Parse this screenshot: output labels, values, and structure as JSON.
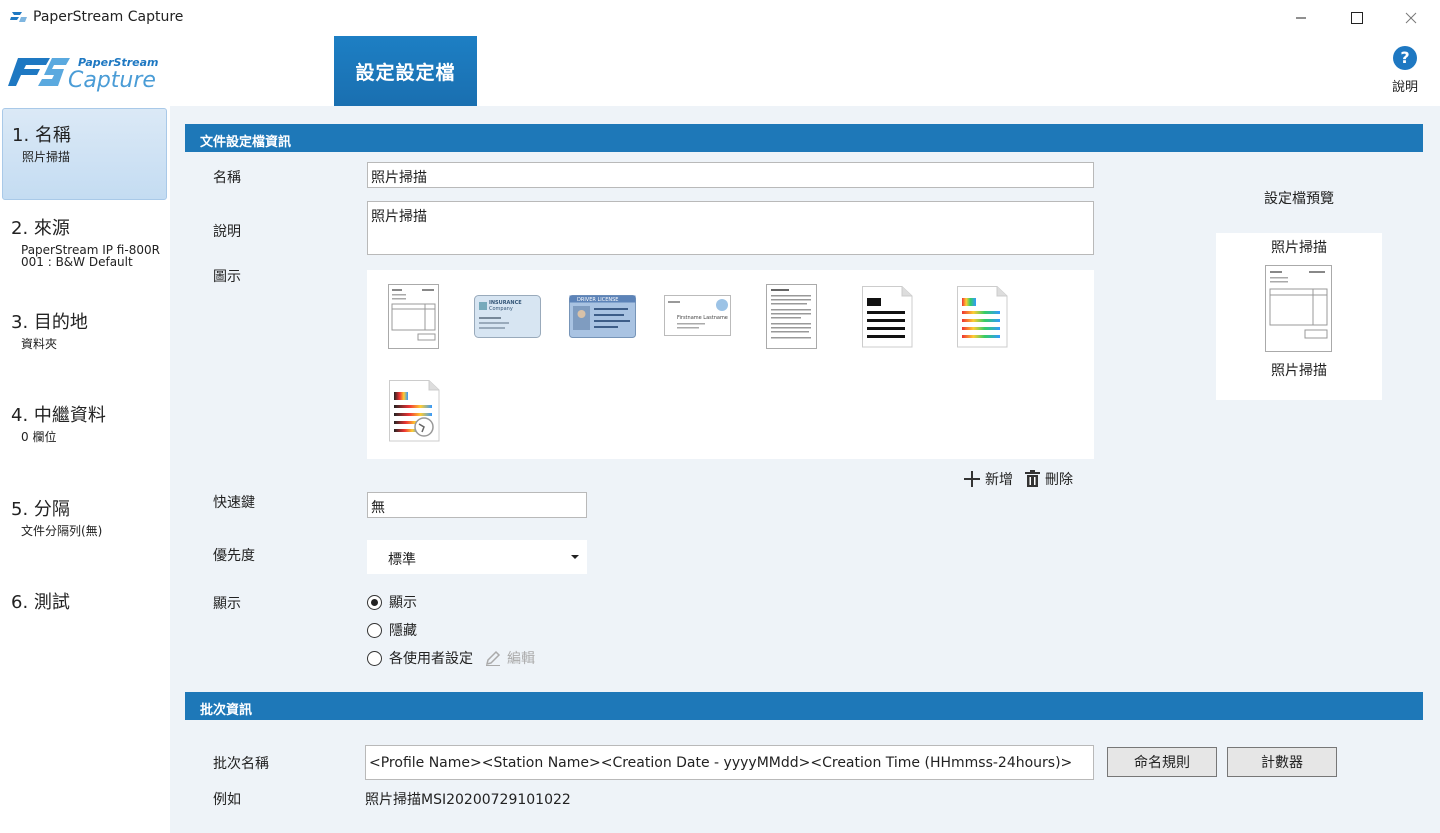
{
  "window": {
    "title": "PaperStream Capture"
  },
  "header": {
    "logo_top": "PaperStream",
    "logo_main": "Capture",
    "active_tab": "設定設定檔",
    "help_label": "說明"
  },
  "sidebar": {
    "steps": [
      {
        "title": "1. 名稱",
        "sub": "照片掃描"
      },
      {
        "title": "2. 來源",
        "sub": "PaperStream IP fi-800R",
        "sub2": "001 : B&W Default"
      },
      {
        "title": "3. 目的地",
        "sub": "資料夾"
      },
      {
        "title": "4. 中繼資料",
        "sub": "0 欄位"
      },
      {
        "title": "5. 分隔",
        "sub": "文件分隔列(無)"
      },
      {
        "title": "6. 測試",
        "sub": ""
      }
    ]
  },
  "profile": {
    "section_title": "文件設定檔資訊",
    "name_label": "名稱",
    "name_value": "照片掃描",
    "desc_label": "說明",
    "desc_value": "照片掃描",
    "icon_label": "圖示",
    "add_label": "新增",
    "delete_label": "刪除",
    "hotkey_label": "快速鍵",
    "hotkey_value": "無",
    "priority_label": "優先度",
    "priority_value": "標準",
    "display_label": "顯示",
    "display_options": [
      {
        "label": "顯示",
        "selected": true
      },
      {
        "label": "隱藏",
        "selected": false
      },
      {
        "label": "各使用者設定",
        "selected": false
      }
    ],
    "edit_label": "編輯"
  },
  "preview": {
    "title": "設定檔預覽",
    "name_top": "照片掃描",
    "name_bottom": "照片掃描"
  },
  "batch": {
    "section_title": "批次資訊",
    "name_label": "批次名稱",
    "name_value": "<Profile Name><Station Name><Creation Date - yyyyMMdd><Creation Time (HHmmss-24hours)>",
    "naming_rule_button": "命名規則",
    "counter_button": "計數器",
    "example_label": "例如",
    "example_value": "照片掃描MSI20200729101022"
  },
  "card_texts": {
    "insurance": "INSURANCE",
    "company": "Company",
    "license": "DRIVER LICENSE",
    "firstname": "Firstname Lastname"
  }
}
